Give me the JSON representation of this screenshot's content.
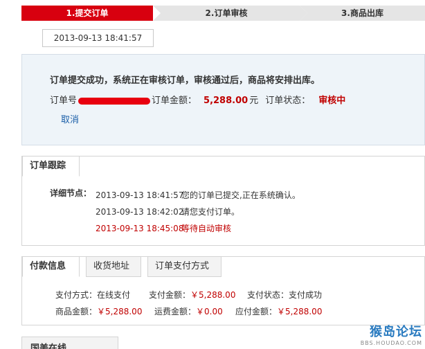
{
  "steps": [
    {
      "label": "1.提交订单",
      "active": true
    },
    {
      "label": "2.订单审核",
      "active": false
    },
    {
      "label": "3.商品出库",
      "active": false
    }
  ],
  "order_time": "2013-09-13 18:41:57",
  "status_panel": {
    "message": "订单提交成功，系统正在审核订单，审核通过后，商品将安排出库。",
    "order_no_label": "订单号",
    "amount_label": "订单金额：",
    "amount_value": "5,288.00",
    "amount_unit": "元",
    "state_label": "订单状态：",
    "state_value": "审核中",
    "cancel_label": "取消"
  },
  "tracking": {
    "tab_label": "订单跟踪",
    "detail_label": "详细节点：",
    "entries": [
      {
        "time": "2013-09-13 18:41:57",
        "text": "您的订单已提交,正在系统确认。",
        "highlight": false
      },
      {
        "time": "2013-09-13 18:42:02",
        "text": "请您支付订单。",
        "highlight": false
      },
      {
        "time": "2013-09-13 18:45:08",
        "text": "等待自动审核",
        "highlight": true
      }
    ]
  },
  "payment": {
    "tabs": [
      "付款信息",
      "收货地址",
      "订单支付方式"
    ],
    "method_label": "支付方式：",
    "method_value": "在线支付",
    "paid_label": "支付金额：",
    "paid_value": "￥5,288.00",
    "status_label": "支付状态：",
    "status_value": "支付成功",
    "goods_label": "商品金额：",
    "goods_value": "￥5,288.00",
    "shipping_label": "运费金额：",
    "shipping_value": "￥0.00",
    "payable_label": "应付金额：",
    "payable_value": "￥5,288.00"
  },
  "next_section": {
    "title": "国美在线"
  },
  "watermark": {
    "main": "猴岛论坛",
    "sub": "BBS.HOUDAO.COM"
  },
  "colors": {
    "accent_red": "#d8000f",
    "panel_bg": "#eef4f9",
    "link_blue": "#1a5ea8"
  }
}
